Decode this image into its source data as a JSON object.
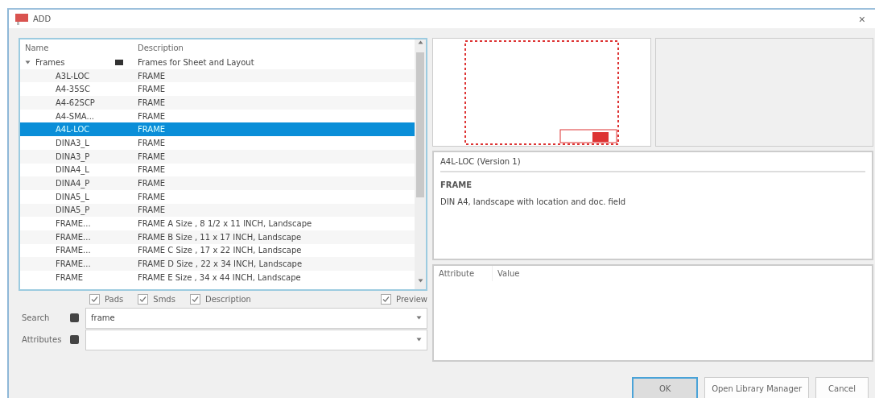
{
  "window": {
    "title": "ADD",
    "close": "×"
  },
  "table": {
    "columns": [
      "Name",
      "",
      "Description"
    ],
    "rows": [
      {
        "name": "Frames",
        "description": "Frames for Sheet and Layout",
        "expanded": true,
        "selected": false,
        "children": [
          {
            "name": "A3L-LOC",
            "description": "FRAME",
            "selected": false
          },
          {
            "name": "A4-35SC",
            "description": "FRAME",
            "selected": false
          },
          {
            "name": "A4-62SCP",
            "description": "FRAME",
            "selected": false
          },
          {
            "name": "A4-SMA...",
            "description": "FRAME",
            "selected": false
          },
          {
            "name": "A4L-LOC",
            "description": "FRAME",
            "selected": true
          },
          {
            "name": "DINA3_L",
            "description": "FRAME",
            "selected": false
          },
          {
            "name": "DINA3_P",
            "description": "FRAME",
            "selected": false
          },
          {
            "name": "DINA4_L",
            "description": "FRAME",
            "selected": false
          },
          {
            "name": "DINA4_P",
            "description": "FRAME",
            "selected": false
          },
          {
            "name": "DINA5_L",
            "description": "FRAME",
            "selected": false
          },
          {
            "name": "DINA5_P",
            "description": "FRAME",
            "selected": false
          },
          {
            "name": "FRAME...",
            "description": "FRAME A Size , 8 1/2 x 11 INCH, Landscape",
            "selected": false
          },
          {
            "name": "FRAME...",
            "description": "FRAME B Size , 11 x 17 INCH, Landscape",
            "selected": false
          },
          {
            "name": "FRAME...",
            "description": "FRAME C Size , 17 x 22 INCH, Landscape",
            "selected": false
          },
          {
            "name": "FRAME...",
            "description": "FRAME D Size , 22 x 34 INCH, Landscape",
            "selected": false
          },
          {
            "name": "FRAME",
            "description": "FRAME E Size , 34 x 44 INCH, Landscape",
            "selected": false
          }
        ]
      }
    ]
  },
  "filters": [
    {
      "label": "Pads",
      "checked": true
    },
    {
      "label": "Smds",
      "checked": true
    },
    {
      "label": "Description",
      "checked": true
    },
    {
      "label": "Preview",
      "checked": true
    }
  ],
  "search": {
    "label": "Search",
    "value": "frame"
  },
  "attributes_filter": {
    "label": "Attributes"
  },
  "details": {
    "title": "A4L-LOC (Version 1)",
    "heading": "FRAME",
    "description": "DIN A4, landscape with location and doc. field"
  },
  "attribute_table": {
    "columns": [
      "Attribute",
      "Value"
    ]
  },
  "buttons": [
    {
      "label": "OK",
      "kind": "default"
    },
    {
      "label": "Open Library Manager",
      "kind": "normal"
    },
    {
      "label": "Cancel",
      "kind": "normal"
    }
  ]
}
